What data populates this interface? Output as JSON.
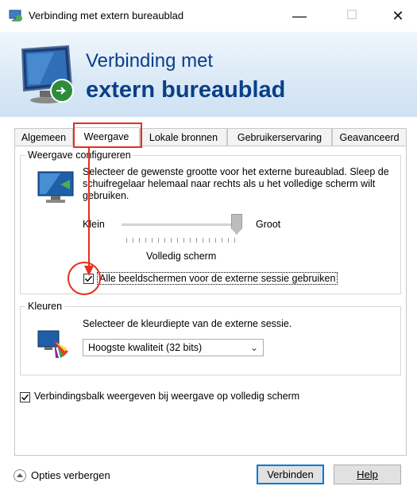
{
  "window": {
    "title": "Verbinding met extern bureaublad",
    "minimize_glyph": "—",
    "maximize_glyph": "☐",
    "close_glyph": "✕"
  },
  "banner": {
    "line1": "Verbinding met",
    "line2": "extern bureaublad"
  },
  "tabs": [
    {
      "label": "Algemeen",
      "active": false
    },
    {
      "label": "Weergave",
      "active": true
    },
    {
      "label": "Lokale bronnen",
      "active": false
    },
    {
      "label": "Gebruikerservaring",
      "active": false
    },
    {
      "label": "Geavanceerd",
      "active": false
    }
  ],
  "display": {
    "legend": "Weergave configureren",
    "description": "Selecteer de gewenste grootte voor het externe bureaublad. Sleep de schuifregelaar helemaal naar rechts als u het volledige scherm wilt gebruiken.",
    "slider_min_label": "Klein",
    "slider_max_label": "Groot",
    "slider_value_label": "Volledig scherm",
    "slider_level": 1.0,
    "use_all_monitors_label": "Alle beeldschermen voor de externe sessie gebruiken",
    "use_all_monitors_checked": true
  },
  "colors": {
    "legend": "Kleuren",
    "description": "Selecteer de kleurdiepte van de externe sessie.",
    "selected_depth": "Hoogste kwaliteit (32 bits)"
  },
  "connection_bar": {
    "label": "Verbindingsbalk weergeven bij weergave op volledig scherm",
    "checked": true
  },
  "footer": {
    "options_label": "Opties verbergen",
    "connect_label": "Verbinden",
    "help_label": "Help"
  },
  "annotations": {
    "highlight_color": "#e3301f"
  }
}
